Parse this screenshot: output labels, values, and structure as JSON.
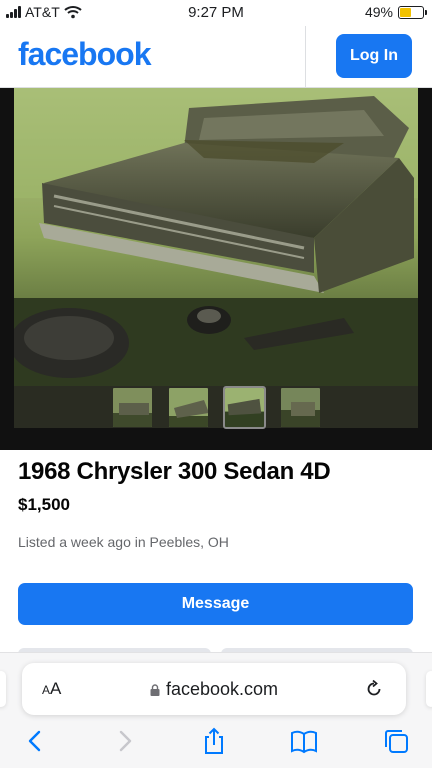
{
  "status_bar": {
    "carrier": "AT&T",
    "time": "9:27 PM",
    "battery_percent": "49%",
    "battery_level": 0.49
  },
  "header": {
    "logo": "facebook",
    "login_label": "Log In",
    "brand_color": "#1877f2"
  },
  "gallery": {
    "thumbnail_count": 4,
    "active_index": 2
  },
  "listing": {
    "title": "1968 Chrysler 300 Sedan 4D",
    "price": "$1,500",
    "meta": "Listed a week ago in Peebles, OH",
    "message_label": "Message"
  },
  "safari": {
    "text_size_label": "AA",
    "url": "facebook.com",
    "icons": [
      "back-icon",
      "forward-icon",
      "share-icon",
      "bookmarks-icon",
      "tabs-icon",
      "reload-icon",
      "lock-icon"
    ]
  }
}
